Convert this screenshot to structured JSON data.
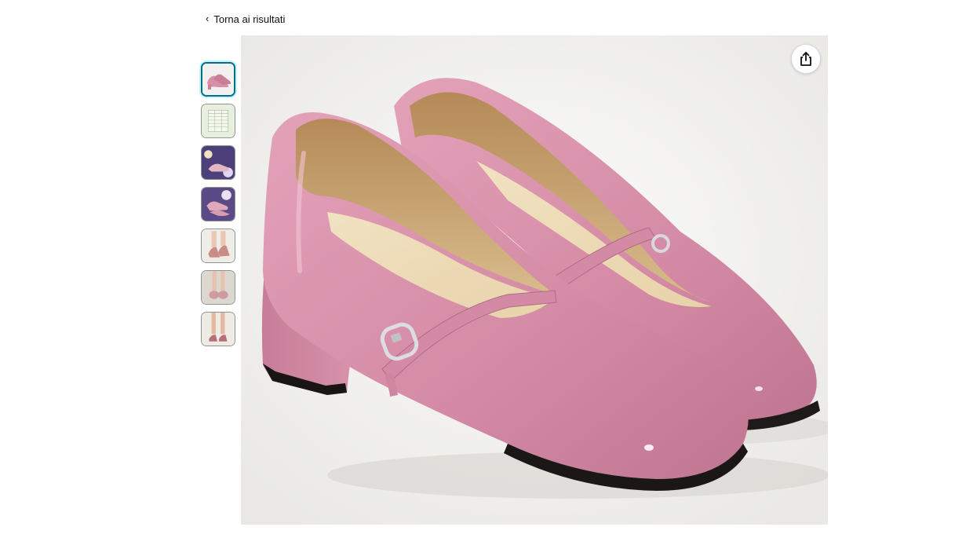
{
  "nav": {
    "back_label": "Torna ai risultati",
    "back_icon": "chevron-left-icon"
  },
  "gallery": {
    "selected_index": 0,
    "thumbnail_count": 7,
    "thumbnails": [
      {
        "kind": "product-photo-pink-heels"
      },
      {
        "kind": "size-chart"
      },
      {
        "kind": "lifestyle-purple-background"
      },
      {
        "kind": "lifestyle-purple-background-2"
      },
      {
        "kind": "worn-on-feet-side"
      },
      {
        "kind": "worn-on-feet-front"
      },
      {
        "kind": "worn-on-feet-standing"
      }
    ]
  },
  "main_image": {
    "subject": "pink patent mary jane block-heel pumps",
    "share_icon": "share-icon"
  },
  "colors": {
    "selected_border": "#007185",
    "shoe_pink": "#d88fa8",
    "lining": "#c9a676"
  }
}
